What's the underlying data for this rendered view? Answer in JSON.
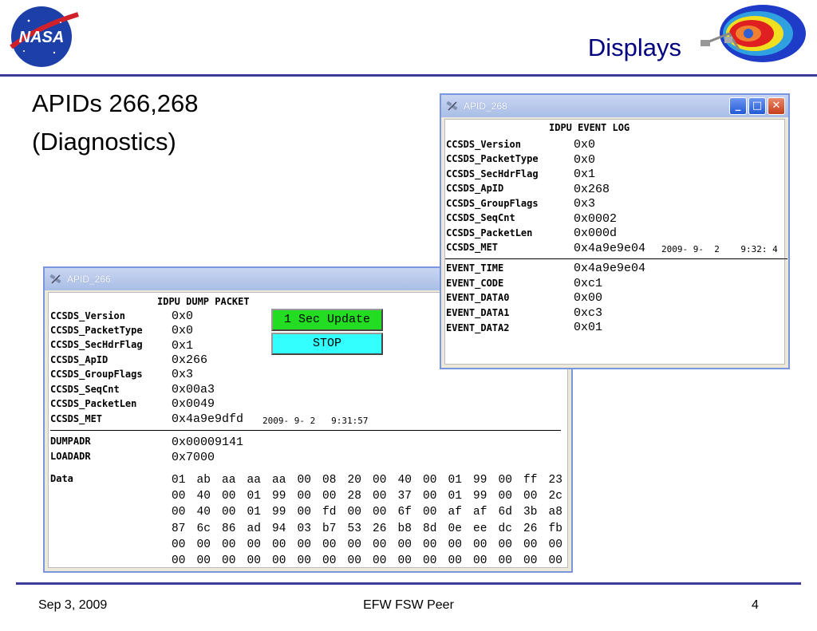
{
  "slide": {
    "title": "Displays",
    "heading_line1": "APIDs 266,268",
    "heading_line2": "(Diagnostics)",
    "logo_text": "NASA",
    "footer_date": "Sep 3, 2009",
    "footer_center": "EFW FSW Peer",
    "page_number": "4"
  },
  "colors": {
    "rule": "#3b3b9a",
    "title": "#000080",
    "update_button": "#22dd22",
    "stop_button": "#33ffff"
  },
  "win266": {
    "title": "APID_266",
    "panel_title": "IDPU DUMP PACKET",
    "fields": [
      {
        "label": "CCSDS_Version",
        "value": "0x0"
      },
      {
        "label": "CCSDS_PacketType",
        "value": "0x0"
      },
      {
        "label": "CCSDS_SecHdrFlag",
        "value": "0x1"
      },
      {
        "label": "CCSDS_ApID",
        "value": "0x266"
      },
      {
        "label": "CCSDS_GroupFlags",
        "value": "0x3"
      },
      {
        "label": "CCSDS_SeqCnt",
        "value": "0x00a3"
      },
      {
        "label": "CCSDS_PacketLen",
        "value": "0x0049"
      },
      {
        "label": "CCSDS_MET",
        "value": "0x4a9e9dfd"
      }
    ],
    "met_time": "2009- 9- 2   9:31:57",
    "update_button": "1 Sec Update",
    "stop_button": "STOP",
    "dumpadr_label": "DUMPADR",
    "dumpadr_value": "0x00009141",
    "loadadr_label": "LOADADR",
    "loadadr_value": "0x7000",
    "data_label": "Data",
    "data_rows": [
      [
        "01",
        "ab",
        "aa",
        "aa",
        "aa",
        "00",
        "08",
        "20",
        "00",
        "40",
        "00",
        "01",
        "99",
        "00",
        "ff",
        "23"
      ],
      [
        "00",
        "40",
        "00",
        "01",
        "99",
        "00",
        "00",
        "28",
        "00",
        "37",
        "00",
        "01",
        "99",
        "00",
        "00",
        "2c"
      ],
      [
        "00",
        "40",
        "00",
        "01",
        "99",
        "00",
        "fd",
        "00",
        "00",
        "6f",
        "00",
        "af",
        "af",
        "6d",
        "3b",
        "a8"
      ],
      [
        "87",
        "6c",
        "86",
        "ad",
        "94",
        "03",
        "b7",
        "53",
        "26",
        "b8",
        "8d",
        "0e",
        "ee",
        "dc",
        "26",
        "fb"
      ],
      [
        "00",
        "00",
        "00",
        "00",
        "00",
        "00",
        "00",
        "00",
        "00",
        "00",
        "00",
        "00",
        "00",
        "00",
        "00",
        "00"
      ],
      [
        "00",
        "00",
        "00",
        "00",
        "00",
        "00",
        "00",
        "00",
        "00",
        "00",
        "00",
        "00",
        "00",
        "00",
        "00",
        "00"
      ]
    ]
  },
  "win268": {
    "title": "APID_268",
    "panel_title": "IDPU EVENT LOG",
    "fields": [
      {
        "label": "CCSDS_Version",
        "value": "0x0"
      },
      {
        "label": "CCSDS_PacketType",
        "value": "0x0"
      },
      {
        "label": "CCSDS_SecHdrFlag",
        "value": "0x1"
      },
      {
        "label": "CCSDS_ApID",
        "value": "0x268"
      },
      {
        "label": "CCSDS_GroupFlags",
        "value": "0x3"
      },
      {
        "label": "CCSDS_SeqCnt",
        "value": "0x0002"
      },
      {
        "label": "CCSDS_PacketLen",
        "value": "0x000d"
      },
      {
        "label": "CCSDS_MET",
        "value": "0x4a9e9e04"
      }
    ],
    "met_time": "2009- 9-  2    9:32: 4",
    "events": [
      {
        "label": "EVENT_TIME",
        "value": "0x4a9e9e04"
      },
      {
        "label": "EVENT_CODE",
        "value": "0xc1"
      },
      {
        "label": "EVENT_DATA0",
        "value": "0x00"
      },
      {
        "label": "EVENT_DATA1",
        "value": "0xc3"
      },
      {
        "label": "EVENT_DATA2",
        "value": "0x01"
      }
    ]
  }
}
